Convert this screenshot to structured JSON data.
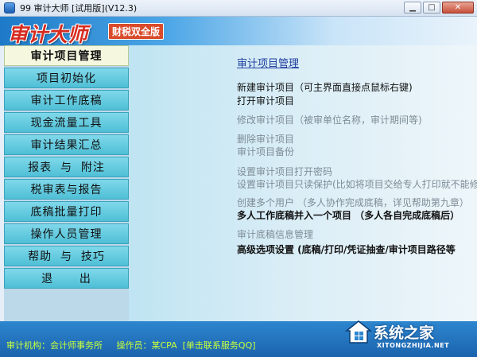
{
  "window": {
    "title": "99  审计大师 [试用版](V12.3)",
    "minimize_label": "▁",
    "maximize_label": "□",
    "close_label": "✕"
  },
  "banner": {
    "logo_text": "审计大师",
    "badge_text": "财税双全版"
  },
  "sidebar": {
    "items": [
      {
        "label": "审计项目管理",
        "active": true
      },
      {
        "label": "项目初始化",
        "active": false
      },
      {
        "label": "审计工作底稿",
        "active": false
      },
      {
        "label": "现金流量工具",
        "active": false
      },
      {
        "label": "审计结果汇总",
        "active": false
      },
      {
        "label": "报表  与  附注",
        "active": false
      },
      {
        "label": "税审表与报告",
        "active": false
      },
      {
        "label": "底稿批量打印",
        "active": false
      },
      {
        "label": "操作人员管理",
        "active": false
      },
      {
        "label": "帮助  与  技巧",
        "active": false
      },
      {
        "label": "退      出",
        "active": false
      }
    ]
  },
  "main": {
    "section_title": "审计项目管理",
    "actions": [
      {
        "label": "新建审计项目（可主界面直接点鼠标右键)",
        "enabled": true,
        "bold": false
      },
      {
        "label": "打开审计项目",
        "enabled": true,
        "bold": false
      },
      {
        "label": "修改审计项目（被审单位名称，审计期间等)",
        "enabled": false,
        "bold": false
      },
      {
        "label": "删除审计项目",
        "enabled": false,
        "bold": false
      },
      {
        "label": "审计项目备份",
        "enabled": false,
        "bold": false
      },
      {
        "label": "设置审计项目打开密码",
        "enabled": false,
        "bold": false
      },
      {
        "label": "设置审计项目只读保护(比如将项目交给专人打印就不能修",
        "enabled": false,
        "bold": false
      },
      {
        "label": "创建多个用户 （多人协作完成底稿，详见帮助第九章）",
        "enabled": false,
        "bold": false
      },
      {
        "label": "多人工作底稿并入一个项目 （多人各自完成底稿后）",
        "enabled": true,
        "bold": true
      },
      {
        "label": "审计底稿信息管理",
        "enabled": false,
        "bold": false
      },
      {
        "label": "高级选项设置 (底稿/打印/凭证抽查/审计项目路径等",
        "enabled": true,
        "bold": true
      }
    ]
  },
  "status": {
    "org_label": "审计机构：",
    "org_value": "会计师事务所",
    "operator_label": "操作员：",
    "operator_value": "某CPA",
    "contact_link": "[单击联系服务QQ]"
  },
  "watermark": {
    "main": "系统之家",
    "sub": "XITONGZHIJIA.NET"
  }
}
